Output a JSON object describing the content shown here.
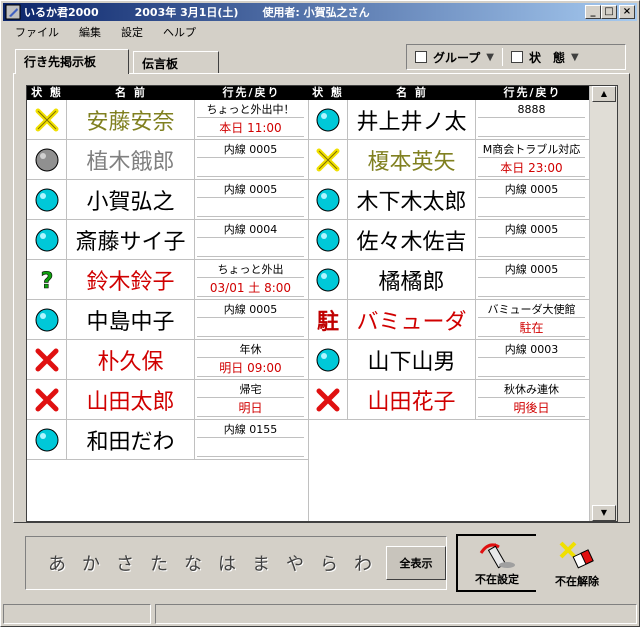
{
  "window": {
    "app_name": "いるか君2000",
    "date": "2003年 3月1日(土)",
    "user": "使用者: 小賀弘之さん",
    "minimize": "_",
    "maximize": "□",
    "close": "×"
  },
  "menu": [
    "ファイル",
    "編集",
    "設定",
    "ヘルプ"
  ],
  "tabs": [
    {
      "label": "行き先掲示板",
      "active": true
    },
    {
      "label": "伝言板",
      "active": false
    }
  ],
  "filters": {
    "group": "グループ",
    "status": "状　態"
  },
  "grid_header": {
    "status": "状 態",
    "name": "名 前",
    "dest": "行先/戻り"
  },
  "people": [
    {
      "status": "out",
      "name": "安藤安奈",
      "name_color": "#808020",
      "dest": "ちょっと外出中！",
      "ret": "本日 11:00"
    },
    {
      "status": "home",
      "name": "井上井ノ太",
      "name_color": "#000000",
      "dest": "8888",
      "ret": ""
    },
    {
      "status": "gray",
      "name": "植木餓郎",
      "name_color": "#808080",
      "dest": "内線 0005",
      "ret": ""
    },
    {
      "status": "out",
      "name": "榎本英矢",
      "name_color": "#808020",
      "dest": "M商会トラブル対応",
      "ret": "本日 23:00"
    },
    {
      "status": "home",
      "name": "小賀弘之",
      "name_color": "#000000",
      "dest": "内線 0005",
      "ret": ""
    },
    {
      "status": "home",
      "name": "木下木太郎",
      "name_color": "#000000",
      "dest": "内線 0005",
      "ret": ""
    },
    {
      "status": "home",
      "name": "斎藤サイ子",
      "name_color": "#000000",
      "dest": "内線 0004",
      "ret": ""
    },
    {
      "status": "home",
      "name": "佐々木佐吉",
      "name_color": "#000000",
      "dest": "内線 0005",
      "ret": ""
    },
    {
      "status": "unknown",
      "name": "鈴木鈴子",
      "name_color": "#d00000",
      "dest": "ちょっと外出",
      "ret": "03/01 土 8:00"
    },
    {
      "status": "home",
      "name": "橘橘郎",
      "name_color": "#000000",
      "dest": "内線 0005",
      "ret": ""
    },
    {
      "status": "home",
      "name": "中島中子",
      "name_color": "#000000",
      "dest": "内線 0005",
      "ret": ""
    },
    {
      "status": "stationed",
      "name": "バミューダ",
      "name_color": "#d00000",
      "dest": "バミューダ大使館",
      "ret": "駐在",
      "status_label": "駐"
    },
    {
      "status": "absent",
      "name": "朴久保",
      "name_color": "#d00000",
      "dest": "年休",
      "ret": "明日 09:00"
    },
    {
      "status": "home",
      "name": "山下山男",
      "name_color": "#000000",
      "dest": "内線 0003",
      "ret": ""
    },
    {
      "status": "absent",
      "name": "山田太郎",
      "name_color": "#d00000",
      "dest": "帰宅",
      "ret": "明日"
    },
    {
      "status": "absent",
      "name": "山田花子",
      "name_color": "#d00000",
      "dest": "秋休み連休",
      "ret": "明後日"
    },
    {
      "status": "home",
      "name": "和田だわ",
      "name_color": "#000000",
      "dest": "内線 0155",
      "ret": ""
    }
  ],
  "kana_index": [
    "あ",
    "か",
    "さ",
    "た",
    "な",
    "は",
    "ま",
    "や",
    "ら",
    "わ"
  ],
  "show_all": "全表示",
  "buttons": {
    "set_absent": "不在設定",
    "clear_absent": "不在解除"
  },
  "colors": {
    "home": "#00c8d8",
    "absent": "#e01010",
    "out": "#f0e000",
    "unknown": "#10a010",
    "stationed": "#c00000"
  }
}
